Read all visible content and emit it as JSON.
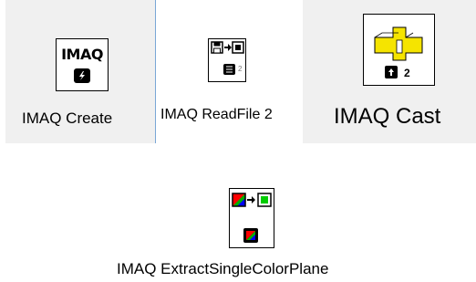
{
  "vis": [
    {
      "label": "IMAQ Create",
      "icon_text": "IMAQ",
      "icon": "imaq-create-icon"
    },
    {
      "label": "IMAQ ReadFile 2",
      "icon_badge": "2",
      "icon": "imaq-readfile-icon"
    },
    {
      "label": "IMAQ Cast",
      "icon_badge": "2",
      "icon": "imaq-cast-icon"
    },
    {
      "label": "IMAQ ExtractSingleColorPlane",
      "icon": "imaq-extract-color-plane-icon"
    }
  ],
  "colors": {
    "panel_bg": "#f0f0f0",
    "cast_yellow": "#f5e400",
    "selection_border": "#7aa7d6"
  }
}
